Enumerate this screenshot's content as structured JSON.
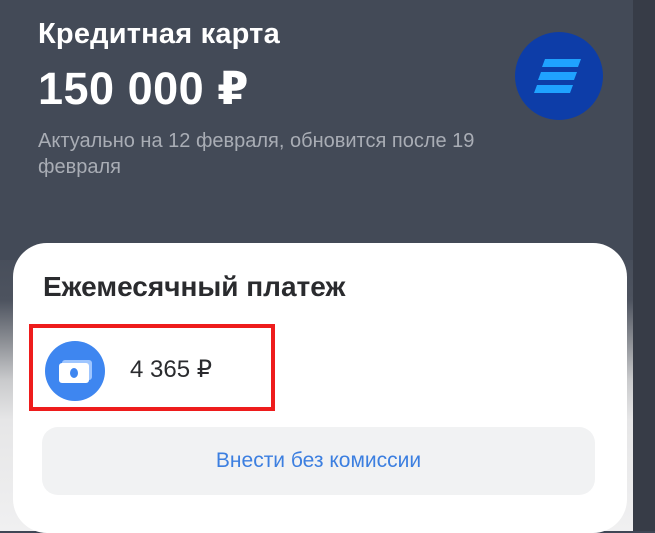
{
  "header": {
    "title": "Кредитная карта",
    "amount": "150 000 ₽",
    "subtitle": "Актуально на 12 февраля, обновится после 19 февраля",
    "logo_icon": "bank-logo-icon"
  },
  "card": {
    "title": "Ежемесячный платеж",
    "payment_icon": "banknote-icon",
    "payment_amount": "4 365 ₽",
    "button_label": "Внести без комиссии"
  },
  "colors": {
    "header_bg": "#434a57",
    "logo_bg": "#0d3da8",
    "logo_stripes": "#1fa2ff",
    "accent_blue": "#3c7fe0",
    "icon_blue": "#3e86f0",
    "highlight_red": "#ee1c1c"
  }
}
